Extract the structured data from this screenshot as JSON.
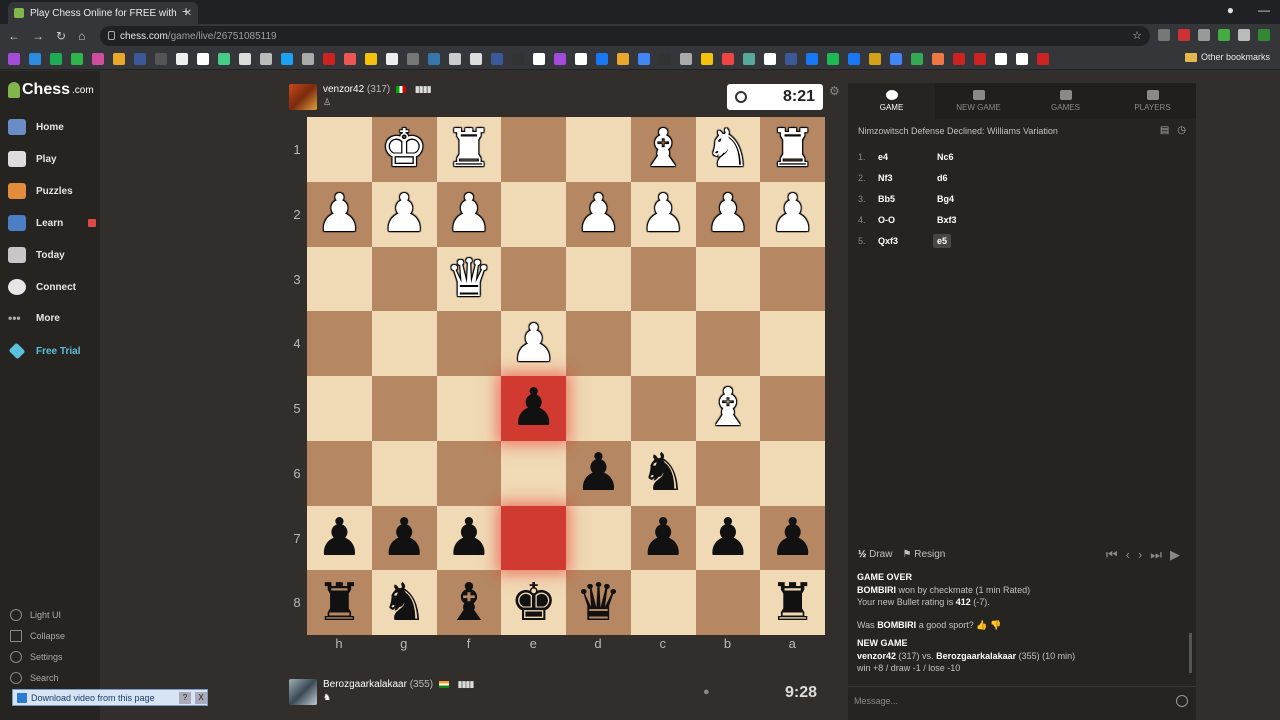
{
  "browser": {
    "tab_title": "Play Chess Online for FREE with",
    "url_host": "chess.com",
    "url_path": "/game/live/26751085119",
    "other_bookmarks": "Other bookmarks"
  },
  "sidebar": {
    "logo": "Chess",
    "logo_suffix": ".com",
    "items": [
      {
        "label": "Home",
        "icon": "home-icon",
        "color": "#6a8dc8"
      },
      {
        "label": "Play",
        "icon": "play-icon",
        "color": "#ddd"
      },
      {
        "label": "Puzzles",
        "icon": "puzzles-icon",
        "color": "#e28c3c"
      },
      {
        "label": "Learn",
        "icon": "learn-icon",
        "color": "#4b7ec4"
      },
      {
        "label": "Today",
        "icon": "today-icon",
        "color": "#c7c7c7"
      },
      {
        "label": "Connect",
        "icon": "connect-icon",
        "color": "#e6e6e6"
      },
      {
        "label": "More",
        "icon": "more-icon",
        "color": "#aaa"
      },
      {
        "label": "Free Trial",
        "icon": "diamond-icon",
        "color": "#5bc0de"
      }
    ],
    "bottom": [
      "Light UI",
      "Collapse",
      "Settings",
      "Search"
    ],
    "download_bar": "Download video from this page"
  },
  "top_player": {
    "name": "venzor42",
    "rating": "(317)",
    "clock": "8:21"
  },
  "bottom_player": {
    "name": "Berozgaarkalakaar",
    "rating": "(355)",
    "clock": "9:28"
  },
  "board": {
    "ranks": [
      "1",
      "2",
      "3",
      "4",
      "5",
      "6",
      "7",
      "8"
    ],
    "files": [
      "h",
      "g",
      "f",
      "e",
      "d",
      "c",
      "b",
      "a"
    ],
    "rows": [
      [
        "",
        "wK",
        "wR",
        "",
        "",
        "wB",
        "wN",
        "wR"
      ],
      [
        "wP",
        "wP",
        "wP",
        "",
        "wP",
        "wP",
        "wP",
        "wP"
      ],
      [
        "",
        "",
        "wQ",
        "",
        "",
        "",
        "",
        ""
      ],
      [
        "",
        "",
        "",
        "wP",
        "",
        "",
        "",
        ""
      ],
      [
        "",
        "",
        "",
        "bP",
        "",
        "",
        "wB",
        ""
      ],
      [
        "",
        "",
        "",
        "",
        "bP",
        "bN",
        "",
        ""
      ],
      [
        "bP",
        "bP",
        "bP",
        "",
        "",
        "bP",
        "bP",
        "bP"
      ],
      [
        "bR",
        "bN",
        "bB",
        "bK",
        "bQ",
        "",
        "",
        "bR"
      ]
    ],
    "highlight": [
      [
        4,
        3
      ],
      [
        6,
        3
      ]
    ]
  },
  "panel": {
    "tabs": [
      "GAME",
      "NEW GAME",
      "GAMES",
      "PLAYERS"
    ],
    "opening": "Nimzowitsch Defense Declined: Williams Variation",
    "moves": [
      {
        "n": "1.",
        "w": "e4",
        "b": "Nc6"
      },
      {
        "n": "2.",
        "w": "Nf3",
        "b": "d6"
      },
      {
        "n": "3.",
        "w": "Bb5",
        "b": "Bg4"
      },
      {
        "n": "4.",
        "w": "O-O",
        "b": "Bxf3"
      },
      {
        "n": "5.",
        "w": "Qxf3",
        "b": "e5"
      }
    ],
    "draw": "Draw",
    "draw_prefix": "½",
    "resign": "Resign",
    "game_over": "GAME OVER",
    "winner": "BOMBIRI",
    "result_text": "won by checkmate (1 min Rated)",
    "rating_text": "Your new Bullet rating is",
    "rating_value": "412",
    "rating_change": "(-7).",
    "sport_q1": "Was",
    "sport_name": "BOMBIRI",
    "sport_q2": "a good sport?",
    "new_game": "NEW GAME",
    "ng_p1": "venzor42",
    "ng_p1_rating": "(317) vs.",
    "ng_p2": "Berozgaarkalakaar",
    "ng_p2_rating": "(355) (10 min)",
    "ng_odds": "win +8 / draw -1 / lose -10",
    "message_placeholder": "Message..."
  }
}
